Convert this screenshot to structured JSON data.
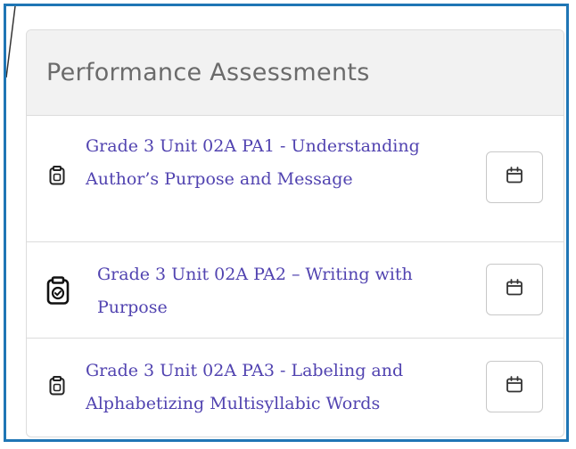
{
  "panel": {
    "title": "Performance Assessments"
  },
  "items": [
    {
      "icon": "clipboard-icon",
      "title": "Grade 3 Unit 02A PA1 - Understanding Author’s Purpose and Message",
      "action_icon": "calendar-icon"
    },
    {
      "icon": "clipboard-check-icon",
      "title": "Grade 3 Unit 02A PA2 – Writing with Purpose",
      "action_icon": "calendar-icon"
    },
    {
      "icon": "clipboard-icon",
      "title": "Grade 3 Unit 02A PA3 - Labeling and Alphabetizing Multisyllabic Words",
      "action_icon": "calendar-icon"
    }
  ],
  "colors": {
    "frame_border": "#1f76b5",
    "link": "#5143b0",
    "header_bg": "#f2f2f2",
    "title_text": "#6b6b6b"
  }
}
